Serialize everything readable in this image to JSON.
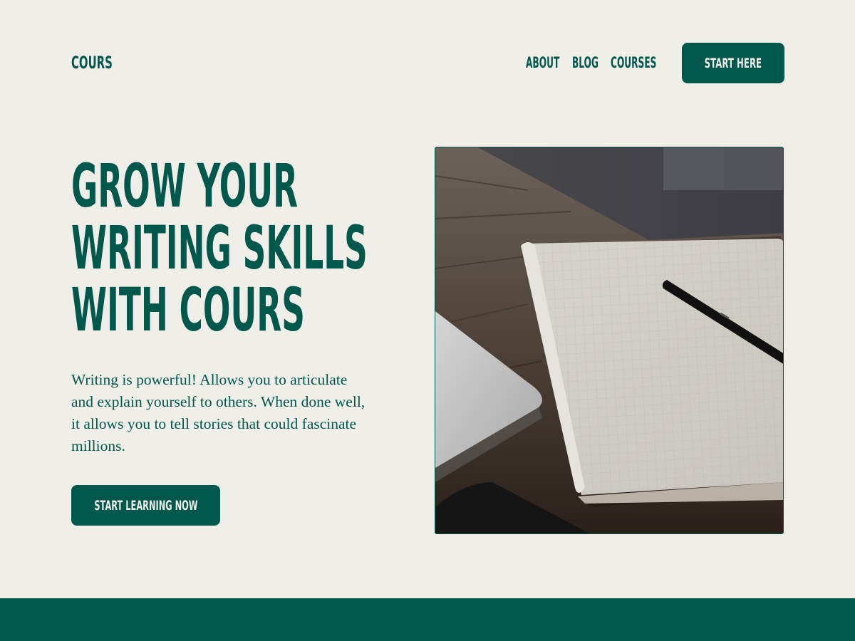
{
  "header": {
    "logo": "COURS",
    "nav": [
      "ABOUT",
      "BLOG",
      "COURSES"
    ],
    "cta_label": "START HERE"
  },
  "hero": {
    "headline_lines": [
      "GROW YOUR",
      "WRITING SKILLS",
      "WITH COURS"
    ],
    "description": "Writing is powerful! Allows you to articulate and explain yourself to others. When done well, it allows you to tell stories that could fascinate millions.",
    "cta_label": "START LEARNING NOW"
  },
  "colors": {
    "brand": "#00574b",
    "background": "#f0eee8"
  }
}
